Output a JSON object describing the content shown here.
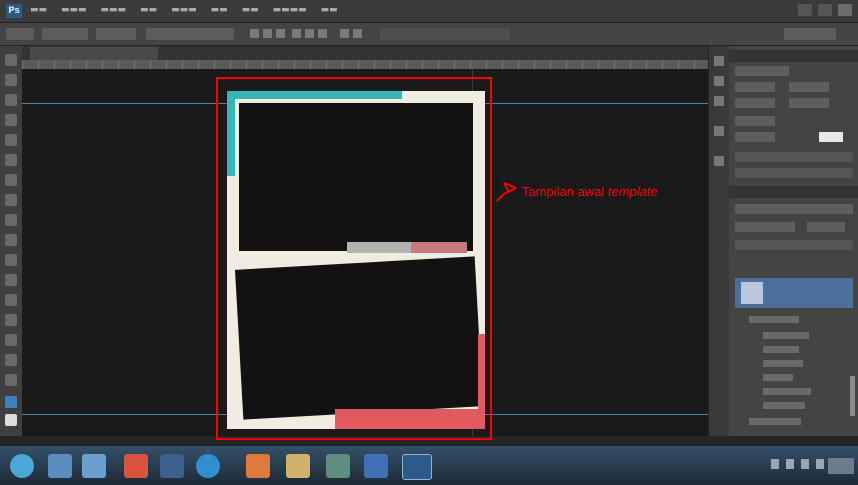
{
  "annotation": {
    "text_normal": "Tampilan awal ",
    "text_italic": "template",
    "color": "#ff0000"
  },
  "template": {
    "accent_teal": "#36b6b4",
    "accent_coral": "#e05a5e",
    "page_color": "#f1ece2"
  }
}
